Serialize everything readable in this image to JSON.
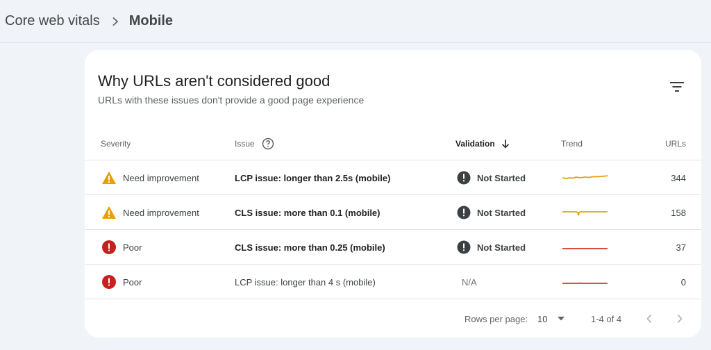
{
  "breadcrumb": {
    "parent": "Core web vitals",
    "current": "Mobile"
  },
  "card": {
    "title": "Why URLs aren't considered good",
    "subtitle": "URLs with these issues don't provide a good page experience"
  },
  "table": {
    "headers": {
      "severity": "Severity",
      "issue": "Issue",
      "validation": "Validation",
      "trend": "Trend",
      "urls": "URLs"
    },
    "rows": [
      {
        "severity": "Need improvement",
        "issue": "LCP issue: longer than 2.5s (mobile)",
        "validation": "Not Started",
        "urls": "344"
      },
      {
        "severity": "Need improvement",
        "issue": "CLS issue: more than 0.1 (mobile)",
        "validation": "Not Started",
        "urls": "158"
      },
      {
        "severity": "Poor",
        "issue": "CLS issue: more than 0.25 (mobile)",
        "validation": "Not Started",
        "urls": "37"
      },
      {
        "severity": "Poor",
        "issue": "LCP issue: longer than 4 s (mobile)",
        "validation": "N/A",
        "urls": "0"
      }
    ]
  },
  "pagination": {
    "rows_per_page_label": "Rows per page:",
    "rows_per_page_value": "10",
    "range": "1-4 of 4"
  },
  "colors": {
    "warning": "#e8a000",
    "error": "#c5221f",
    "validation_icon": "#3c4043",
    "trend_need_improvement": "#e3a008",
    "trend_poor": "#d93025"
  }
}
